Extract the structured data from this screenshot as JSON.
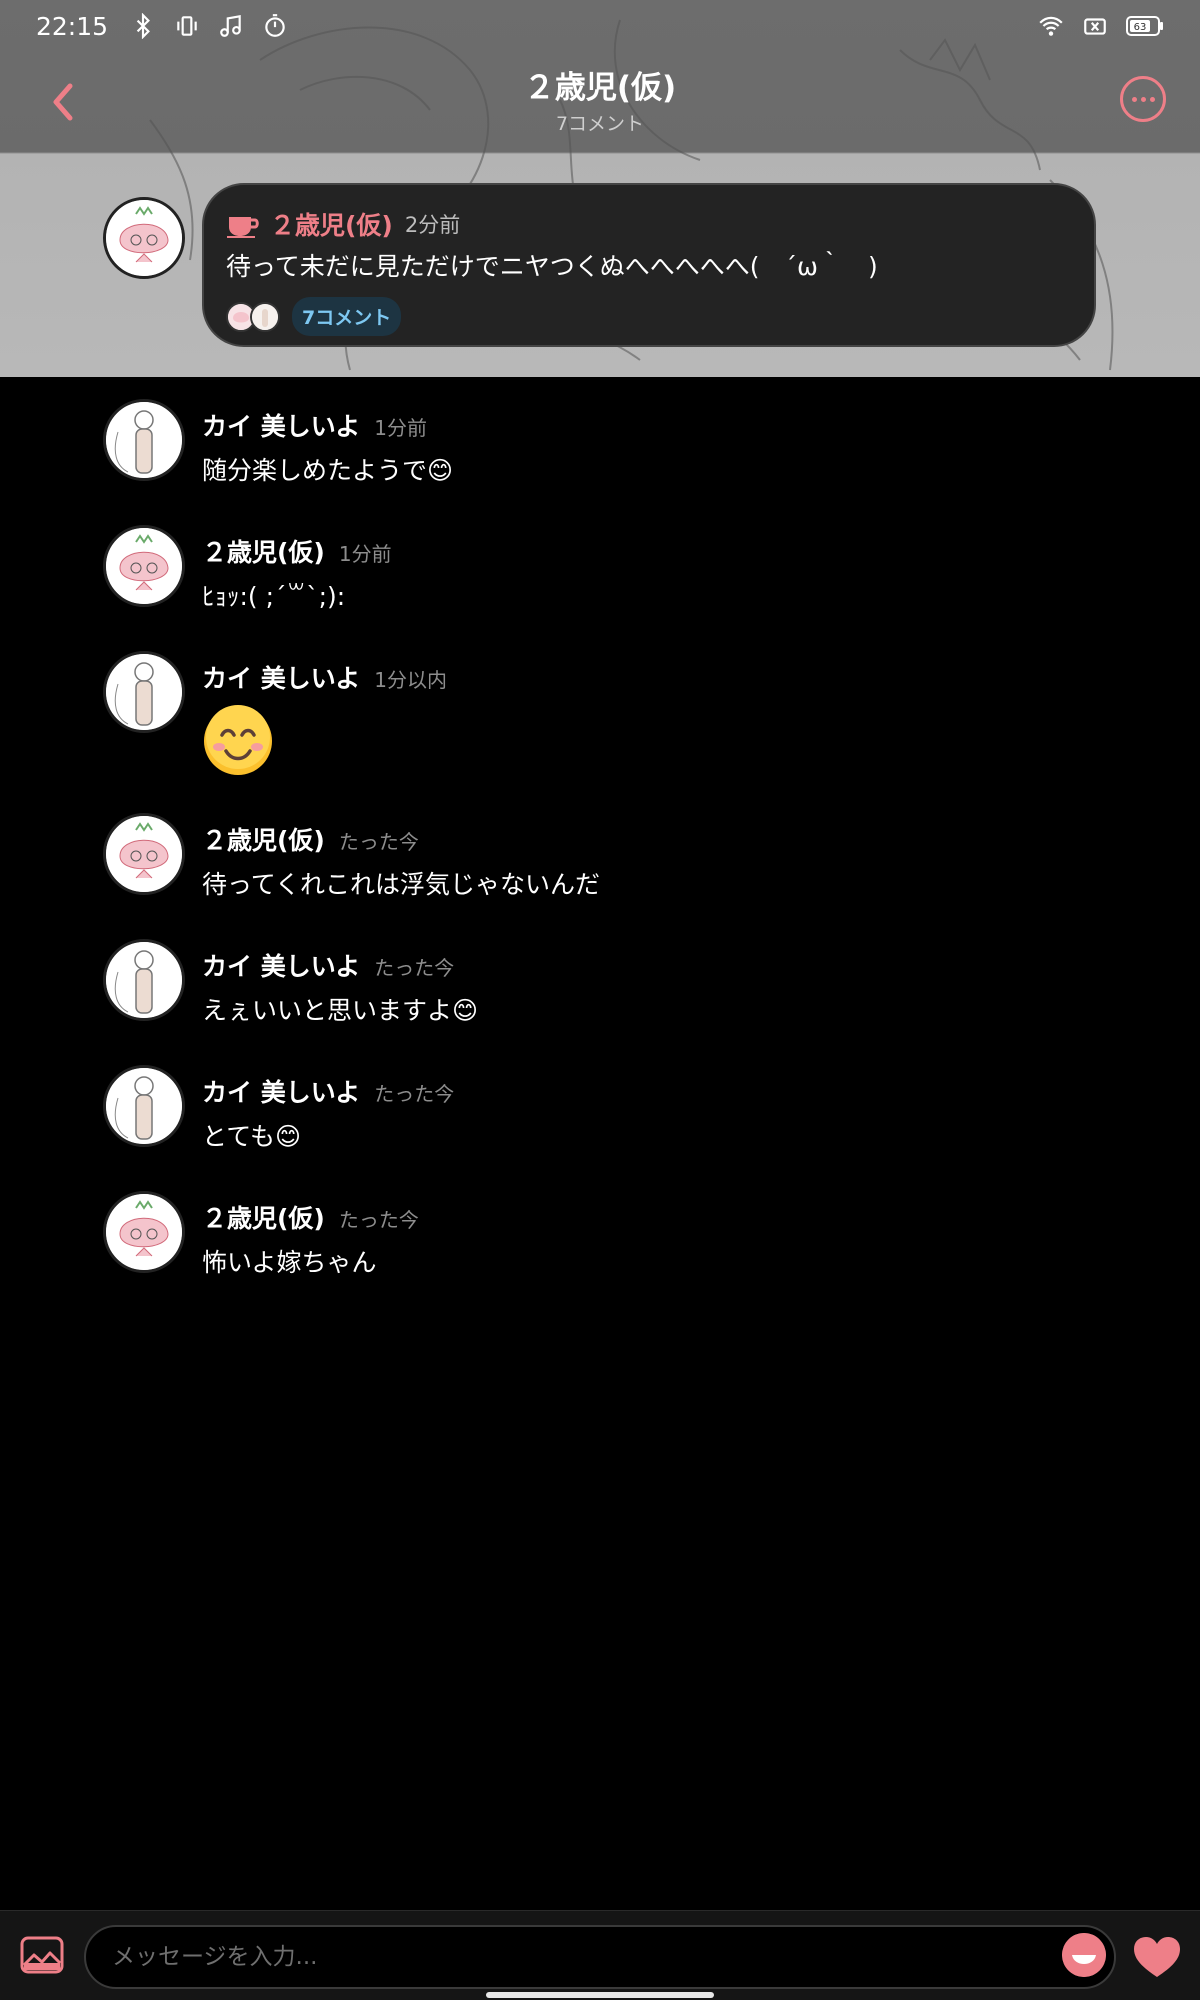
{
  "status_bar": {
    "time": "22:15",
    "battery": "63",
    "icons_left": [
      "bluetooth-icon",
      "vibrate-icon",
      "music-icon",
      "timer-icon"
    ],
    "icons_right": [
      "wifi-icon",
      "no-sim-icon",
      "battery-icon"
    ]
  },
  "header": {
    "title": "２歳児(仮)",
    "subtitle": "7コメント"
  },
  "post": {
    "author": "２歳児(仮)",
    "time": "2分前",
    "text": "待って未だに見ただけでニヤつくぬへへへへへ(　´ω｀　)",
    "comment_badge": "7コメント"
  },
  "comments": [
    {
      "author": "カイ 美しいよ",
      "time": "1分前",
      "text": "随分楽しめたようで😊"
    },
    {
      "author": "２歳児(仮)",
      "time": "1分前",
      "text": "ﾋｮｯ:( ;´꒳`;):"
    },
    {
      "author": "カイ 美しいよ",
      "time": "1分以内",
      "text": ""
    },
    {
      "author": "２歳児(仮)",
      "time": "たった今",
      "text": "待ってくれこれは浮気じゃないんだ"
    },
    {
      "author": "カイ 美しいよ",
      "time": "たった今",
      "text": "えぇいいと思いますよ😊"
    },
    {
      "author": "カイ 美しいよ",
      "time": "たった今",
      "text": "とても😊"
    },
    {
      "author": "２歳児(仮)",
      "time": "たった今",
      "text": "怖いよ嫁ちゃん"
    }
  ],
  "input": {
    "placeholder": "メッセージを入力..."
  },
  "colors": {
    "accent": "#ee7f88",
    "badge_text": "#7ec8f2",
    "background": "#000000",
    "card": "#232323"
  }
}
